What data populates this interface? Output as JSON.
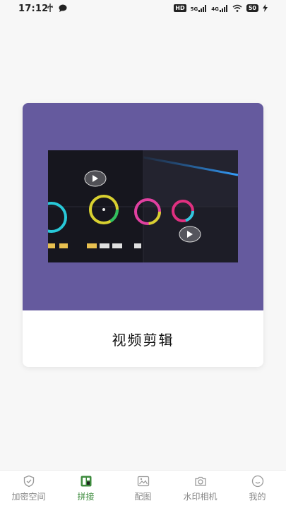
{
  "status_bar": {
    "time": "17:12",
    "left_icons": [
      "usb-icon",
      "message-icon"
    ],
    "hd_label": "HD",
    "signal_1": "5G",
    "signal_2": "4G",
    "battery": "50"
  },
  "card": {
    "title": "视频剪辑",
    "preview_image": "video-editing-color-wheels",
    "colors": {
      "header_bg": "#655a9e"
    }
  },
  "bottom_nav": {
    "items": [
      {
        "label": "加密空间",
        "icon": "shield-icon",
        "active": false
      },
      {
        "label": "拼接",
        "icon": "collage-icon",
        "active": true
      },
      {
        "label": "配图",
        "icon": "image-icon",
        "active": false
      },
      {
        "label": "水印相机",
        "icon": "camera-icon",
        "active": false
      },
      {
        "label": "我的",
        "icon": "profile-icon",
        "active": false
      }
    ],
    "colors": {
      "active": "#3d8b3d",
      "inactive": "#888888"
    }
  }
}
